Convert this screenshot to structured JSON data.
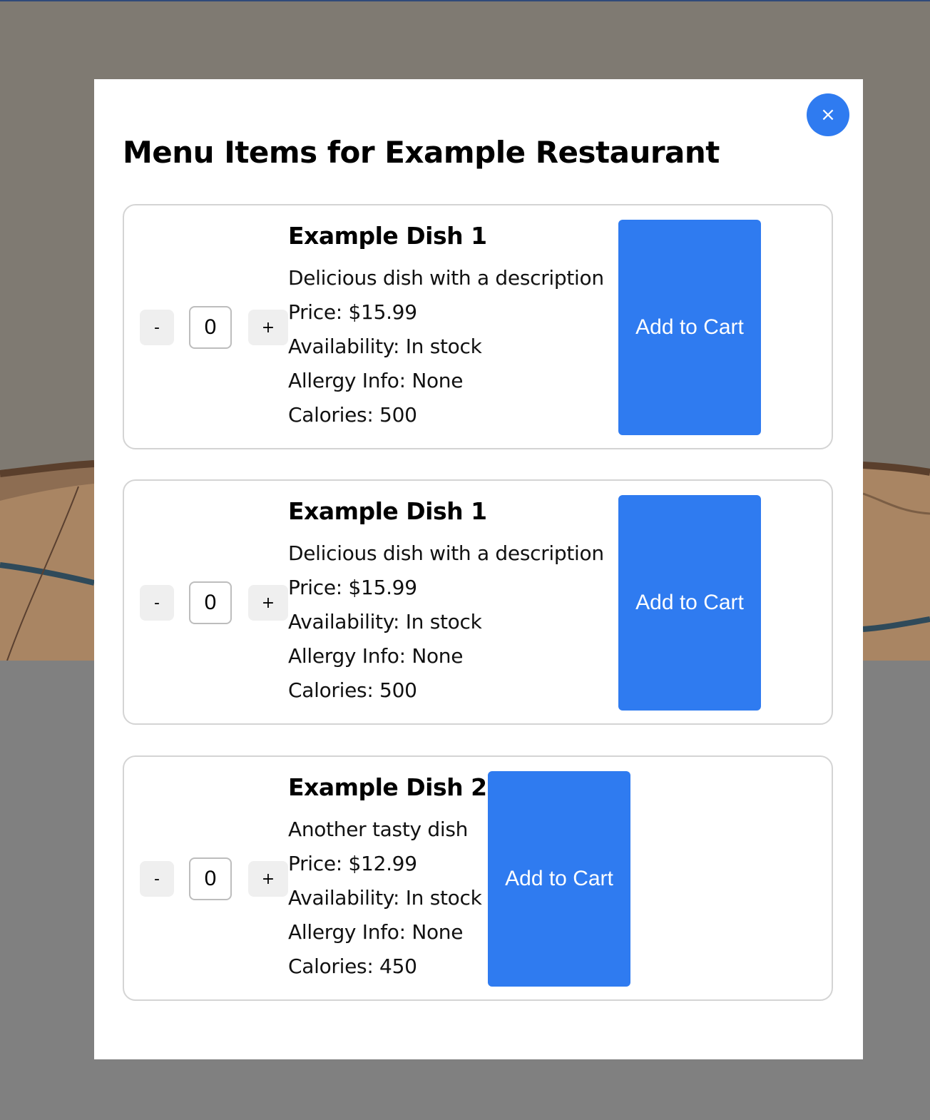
{
  "modal": {
    "title": "Menu Items for Example Restaurant",
    "close_label": "×"
  },
  "items": [
    {
      "name": "Example Dish 1",
      "description": "Delicious dish with a description",
      "price": "Price: $15.99",
      "availability": "Availability: In stock",
      "allergy": "Allergy Info: None",
      "calories": "Calories: 500",
      "quantity": "0",
      "minus_label": "-",
      "plus_label": "+",
      "add_label": "Add to Cart"
    },
    {
      "name": "Example Dish 1",
      "description": "Delicious dish with a description",
      "price": "Price: $15.99",
      "availability": "Availability: In stock",
      "allergy": "Allergy Info: None",
      "calories": "Calories: 500",
      "quantity": "0",
      "minus_label": "-",
      "plus_label": "+",
      "add_label": "Add to Cart"
    },
    {
      "name": "Example Dish 2",
      "description": "Another tasty dish",
      "price": "Price: $12.99",
      "availability": "Availability: In stock",
      "allergy": "Allergy Info: None",
      "calories": "Calories: 450",
      "quantity": "0",
      "minus_label": "-",
      "plus_label": "+",
      "add_label": "Add to Cart"
    }
  ],
  "colors": {
    "accent": "#2f7bf0",
    "overlay": "#808080",
    "card_border": "#d4d4d4"
  }
}
